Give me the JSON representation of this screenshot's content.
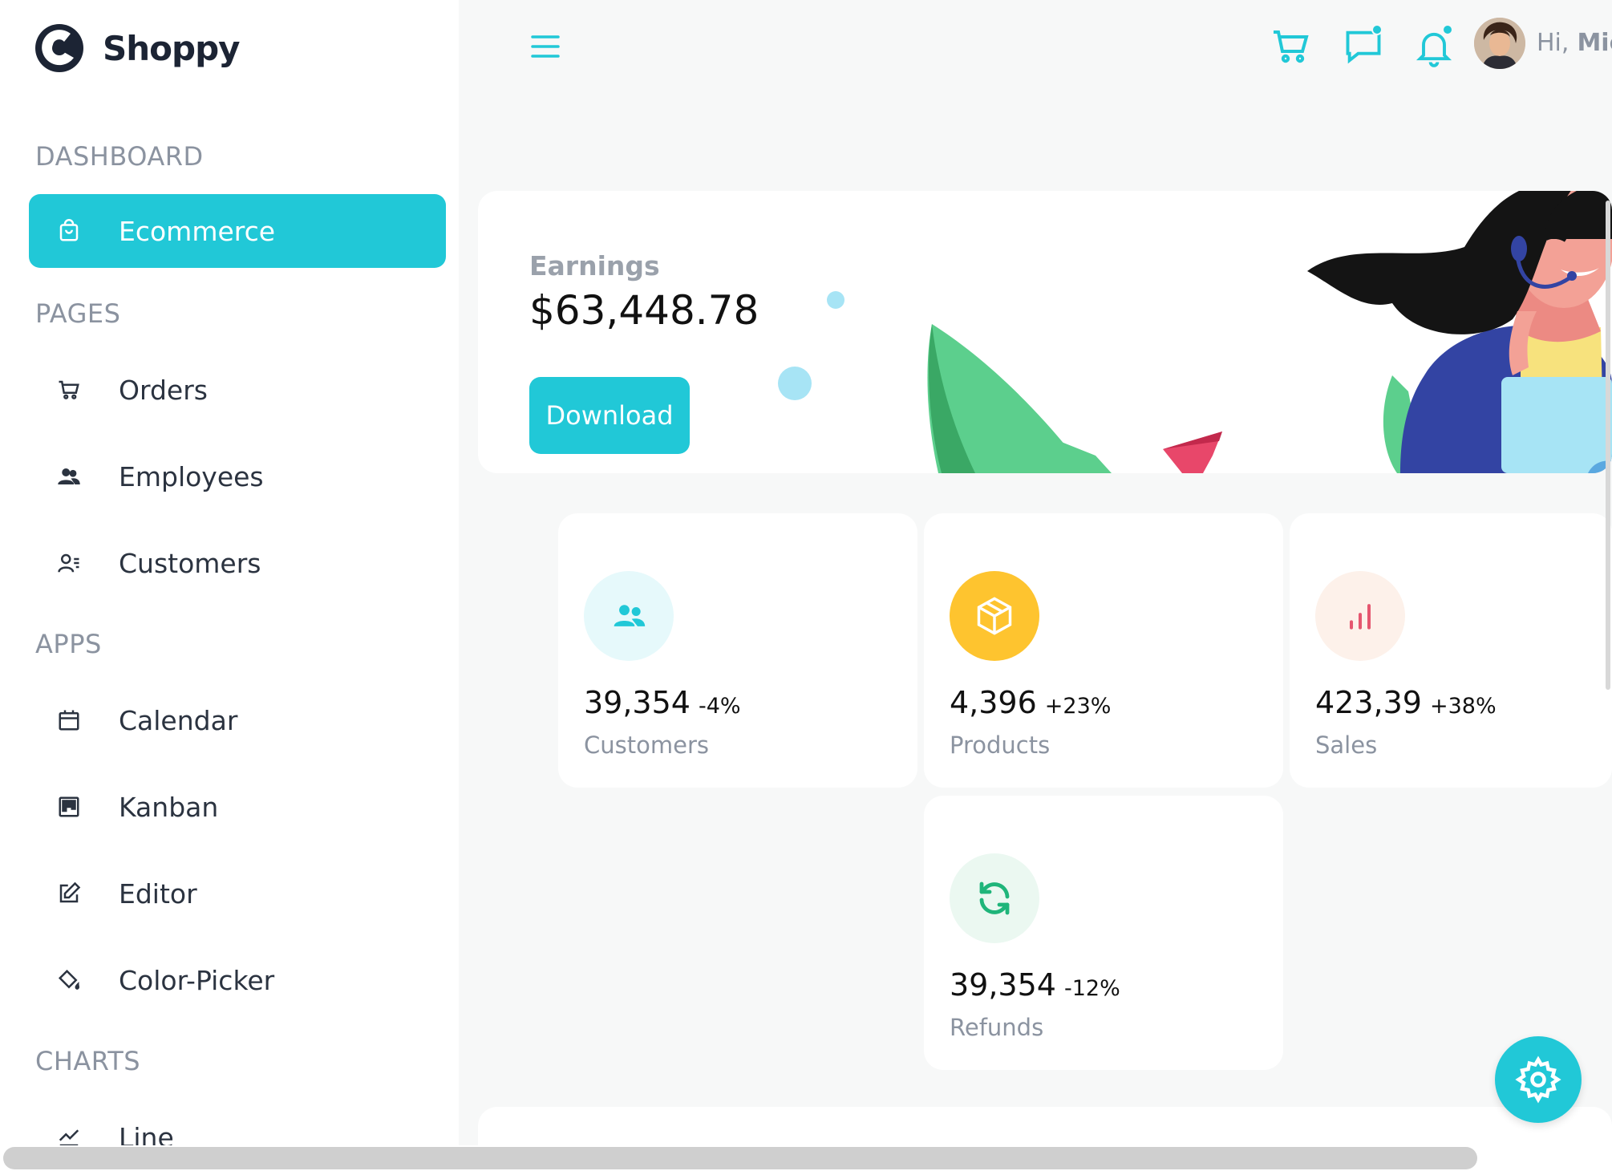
{
  "app": {
    "name": "Shoppy"
  },
  "sidebar": {
    "sections": [
      {
        "title": "DASHBOARD",
        "items": [
          {
            "label": "Ecommerce",
            "icon": "shopping-bag-icon",
            "active": true
          }
        ]
      },
      {
        "title": "PAGES",
        "items": [
          {
            "label": "Orders",
            "icon": "cart-icon"
          },
          {
            "label": "Employees",
            "icon": "people-icon"
          },
          {
            "label": "Customers",
            "icon": "contact-list-icon"
          }
        ]
      },
      {
        "title": "APPS",
        "items": [
          {
            "label": "Calendar",
            "icon": "calendar-icon"
          },
          {
            "label": "Kanban",
            "icon": "kanban-icon"
          },
          {
            "label": "Editor",
            "icon": "edit-icon"
          },
          {
            "label": "Color-Picker",
            "icon": "paint-bucket-icon"
          }
        ]
      },
      {
        "title": "CHARTS",
        "items": [
          {
            "label": "Line",
            "icon": "line-chart-icon"
          }
        ]
      }
    ]
  },
  "header": {
    "greeting": "Hi,",
    "user_name": "Mic",
    "icons": [
      "menu-icon",
      "cart-icon",
      "chat-icon",
      "bell-icon",
      "avatar"
    ]
  },
  "earnings": {
    "label": "Earnings",
    "value": "$63,448.78",
    "button_label": "Download"
  },
  "stats": [
    {
      "value": "39,354",
      "change": "-4%",
      "label": "Customers",
      "icon": "users-icon",
      "icon_color": "#21c8d7",
      "bg": "#e6f9fb"
    },
    {
      "value": "4,396",
      "change": "+23%",
      "label": "Products",
      "icon": "box-icon",
      "icon_color": "#ffffff",
      "bg": "#fec42f"
    },
    {
      "value": "423,39",
      "change": "+38%",
      "label": "Sales",
      "icon": "bar-chart-icon",
      "icon_color": "#e5566f",
      "bg": "#fdf1ea"
    },
    {
      "value": "39,354",
      "change": "-12%",
      "label": "Refunds",
      "icon": "refresh-icon",
      "icon_color": "#1fb57a",
      "bg": "#ebf8f1"
    }
  ],
  "colors": {
    "accent": "#21c8d7",
    "sidebar_bg": "#ffffff",
    "page_bg": "#f7f8f8",
    "muted_text": "#8b93a0"
  }
}
